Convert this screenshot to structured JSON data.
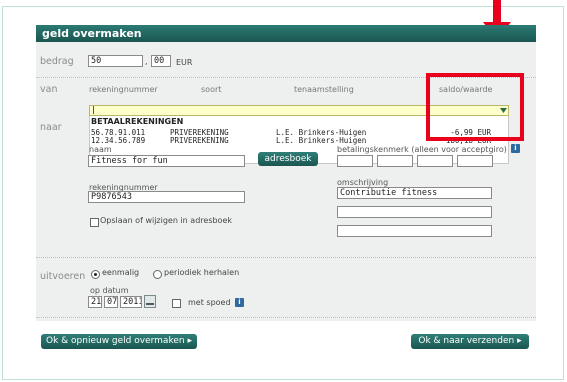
{
  "header": {
    "title": "geld overmaken"
  },
  "bedrag": {
    "label": "bedrag",
    "whole": "50",
    "separator": ",",
    "cents": "00",
    "currency": "EUR"
  },
  "van": {
    "label": "van",
    "columns": {
      "rekeningnummer": "rekeningnummer",
      "soort": "soort",
      "tenaamstelling": "tenaamstelling",
      "saldo": "saldo/waarde"
    },
    "selected_value": "|",
    "group_title": "BETAALREKENINGEN",
    "accounts": [
      {
        "number": "56.78.91.011",
        "type": "PRIVEREKENING",
        "holder": "L.E. Brinkers-Huigen",
        "balance": "-6,99 EUR"
      },
      {
        "number": "12.34.56.789",
        "type": "PRIVEREKENING",
        "holder": "L.E. Brinkers-Huigen",
        "balance": "180,18 EUR"
      }
    ]
  },
  "naar": {
    "label": "naar",
    "naam_label": "naam",
    "naam_value": "Fitness for fun",
    "adresboek_button": "adresboek",
    "rekeningnummer_label": "rekeningnummer",
    "rekeningnummer_value": "P9876543",
    "save_label": "Opslaan of wijzigen in adresboek",
    "kenmerk_label": "betalingskenmerk (alleen voor acceptgiro)",
    "omschrijving_label": "omschrijving",
    "omschrijving_value": "Contributie fitness"
  },
  "uitvoeren": {
    "label": "uitvoeren",
    "option_eenmalig": "eenmalig",
    "option_periodiek": "periodiek herhalen",
    "datum_label": "op datum",
    "day": "21",
    "month": "07",
    "year": "2011",
    "spoed_label": "met spoed",
    "info_glyph": "i"
  },
  "buttons": {
    "ok_opnieuw": "Ok & opnieuw geld overmaken",
    "ok_verzenden": "Ok & naar verzenden",
    "arrow_glyph": "▸"
  },
  "colors": {
    "header": "#1f5e58",
    "highlight": "#e8001c",
    "info": "#2d6aa0"
  },
  "icons": [
    "calendar-icon",
    "info-icon",
    "dropdown-arrow-icon",
    "red-arrow-icon"
  ]
}
